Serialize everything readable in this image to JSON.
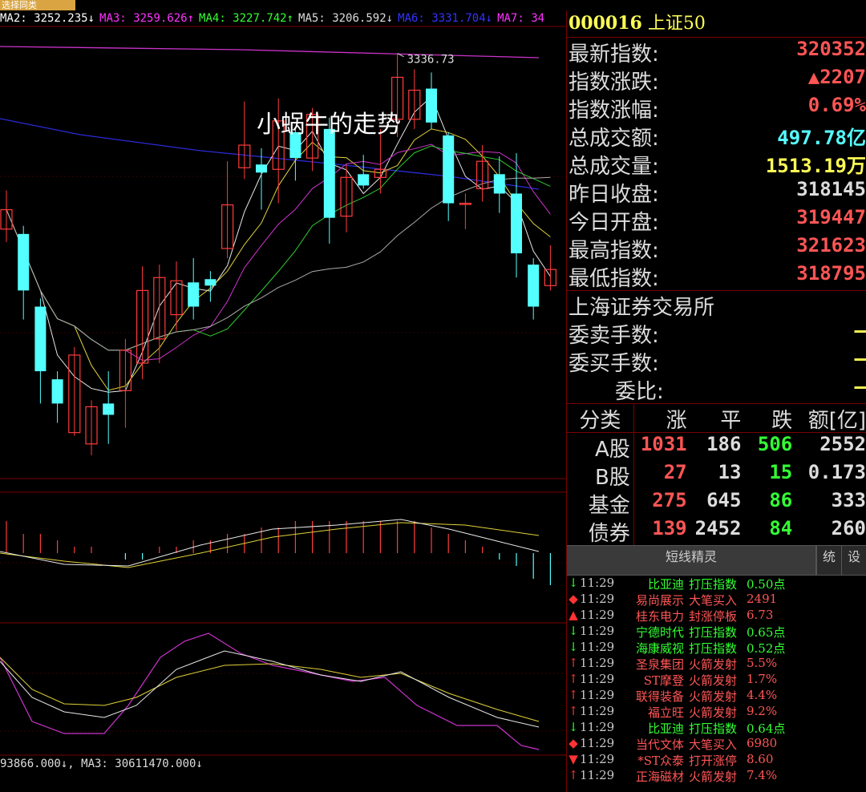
{
  "window": {
    "tab_label": "选择同类"
  },
  "overlay_title": "小蜗牛的走势",
  "ma_bar": [
    {
      "label": "MA2: 3252.235↓",
      "color": "#ffffff"
    },
    {
      "label": "MA3: 3259.626↑",
      "color": "#ff33ff"
    },
    {
      "label": "MA4: 3227.742↑",
      "color": "#33ff33"
    },
    {
      "label": "MA5: 3206.592↓",
      "color": "#dddddd"
    },
    {
      "label": "MA6: 3331.704↓",
      "color": "#3333ff"
    },
    {
      "label": "MA7: 34",
      "color": "#ff33ff"
    }
  ],
  "vol_bar": "93866.000↓, MA3: 30611470.000↓",
  "peak_label": "3336.73",
  "quote": {
    "code": "000016",
    "name": "上证50",
    "rows": [
      {
        "label": "最新指数:",
        "value": "320352",
        "color": "#ff5555"
      },
      {
        "label": "指数涨跌:",
        "value": "▲2207",
        "color": "#ff5555"
      },
      {
        "label": "指数涨幅:",
        "value": "0.69%",
        "color": "#ff5555"
      },
      {
        "label": "总成交额:",
        "value": "497.78亿",
        "color": "#55ffff"
      },
      {
        "label": "总成交量:",
        "value": "1513.19万",
        "color": "#ffff55"
      },
      {
        "label": "昨日收盘:",
        "value": "318145",
        "color": "#dcdcdc"
      },
      {
        "label": "今日开盘:",
        "value": "319447",
        "color": "#ff5555"
      },
      {
        "label": "最高指数:",
        "value": "321623",
        "color": "#ff5555"
      },
      {
        "label": "最低指数:",
        "value": "318795",
        "color": "#ff5555"
      }
    ],
    "exchange": "上海证券交易所",
    "order_rows": [
      {
        "label": "委卖手数:",
        "value": "—"
      },
      {
        "label": "委买手数:",
        "value": "—"
      },
      {
        "label": "委比:",
        "value": "—"
      }
    ]
  },
  "stats": {
    "headers": [
      "分类",
      "涨",
      "平",
      "跌",
      "额[亿]"
    ],
    "rows": [
      {
        "cat": "A股",
        "up": "1031",
        "flat": "186",
        "down": "506",
        "amt": "2552"
      },
      {
        "cat": "B股",
        "up": "27",
        "flat": "13",
        "down": "15",
        "amt": "0.173"
      },
      {
        "cat": "基金",
        "up": "275",
        "flat": "645",
        "down": "86",
        "amt": "333"
      },
      {
        "cat": "债券",
        "up": "139",
        "flat": "2452",
        "down": "84",
        "amt": "260"
      }
    ]
  },
  "tabs": {
    "main": "短线精灵",
    "t1": "统",
    "t2": "设"
  },
  "alerts": [
    {
      "mark": "↓",
      "mark_color": "#33ff33",
      "time": "11:29",
      "name": "比亚迪",
      "type": "打压指数",
      "value": "0.50点",
      "color": "#33ff33"
    },
    {
      "mark": "◆",
      "mark_color": "#ff3333",
      "time": "11:29",
      "name": "易尚展示",
      "type": "大笔买入",
      "value": "2491",
      "color": "#ff5555"
    },
    {
      "mark": "▲",
      "mark_color": "#ff3333",
      "time": "11:29",
      "name": "桂东电力",
      "type": "封涨停板",
      "value": "6.73",
      "color": "#ff5555"
    },
    {
      "mark": "↓",
      "mark_color": "#33ff33",
      "time": "11:29",
      "name": "宁德时代",
      "type": "打压指数",
      "value": "0.65点",
      "color": "#33ff33"
    },
    {
      "mark": "↓",
      "mark_color": "#33ff33",
      "time": "11:29",
      "name": "海康威视",
      "type": "打压指数",
      "value": "0.52点",
      "color": "#33ff33"
    },
    {
      "mark": "↑",
      "mark_color": "#ff3333",
      "time": "11:29",
      "name": "圣泉集团",
      "type": "火箭发射",
      "value": "5.5%",
      "color": "#ff5555"
    },
    {
      "mark": "↑",
      "mark_color": "#ff3333",
      "time": "11:29",
      "name": "ST摩登",
      "type": "火箭发射",
      "value": "1.7%",
      "color": "#ff5555"
    },
    {
      "mark": "↑",
      "mark_color": "#ff3333",
      "time": "11:29",
      "name": "联得装备",
      "type": "火箭发射",
      "value": "4.4%",
      "color": "#ff5555"
    },
    {
      "mark": "↑",
      "mark_color": "#ff3333",
      "time": "11:29",
      "name": "福立旺",
      "type": "火箭发射",
      "value": "9.2%",
      "color": "#ff5555"
    },
    {
      "mark": "↓",
      "mark_color": "#33ff33",
      "time": "11:29",
      "name": "比亚迪",
      "type": "打压指数",
      "value": "0.64点",
      "color": "#33ff33"
    },
    {
      "mark": "◆",
      "mark_color": "#ff3333",
      "time": "11:29",
      "name": "当代文体",
      "type": "大笔买入",
      "value": "6980",
      "color": "#ff5555"
    },
    {
      "mark": "▼",
      "mark_color": "#ff3333",
      "time": "11:29",
      "name": "*ST众泰",
      "type": "打开涨停",
      "value": "8.60",
      "color": "#ff5555"
    },
    {
      "mark": "↑",
      "mark_color": "#ff3333",
      "time": "11:29",
      "name": "正海磁材",
      "type": "火箭发射",
      "value": "7.4%",
      "color": "#ff5555"
    }
  ],
  "chart_data": {
    "type": "candlestick",
    "candles": [
      {
        "o": 3228,
        "c": 3240,
        "h": 3252,
        "l": 3220
      },
      {
        "o": 3225,
        "c": 3190,
        "h": 3230,
        "l": 3172
      },
      {
        "o": 3180,
        "c": 3140,
        "h": 3185,
        "l": 3120
      },
      {
        "o": 3135,
        "c": 3120,
        "h": 3140,
        "l": 3108
      },
      {
        "o": 3102,
        "c": 3150,
        "h": 3155,
        "l": 3100
      },
      {
        "o": 3095,
        "c": 3118,
        "h": 3122,
        "l": 3088
      },
      {
        "o": 3120,
        "c": 3113,
        "h": 3140,
        "l": 3095
      },
      {
        "o": 3128,
        "c": 3153,
        "h": 3160,
        "l": 3105
      },
      {
        "o": 3145,
        "c": 3190,
        "h": 3205,
        "l": 3135
      },
      {
        "o": 3160,
        "c": 3198,
        "h": 3206,
        "l": 3145
      },
      {
        "o": 3175,
        "c": 3196,
        "h": 3208,
        "l": 3165
      },
      {
        "o": 3195,
        "c": 3180,
        "h": 3210,
        "l": 3172
      },
      {
        "o": 3197,
        "c": 3193,
        "h": 3202,
        "l": 3183
      },
      {
        "o": 3216,
        "c": 3243,
        "h": 3270,
        "l": 3210
      },
      {
        "o": 3266,
        "c": 3280,
        "h": 3307,
        "l": 3259
      },
      {
        "o": 3268,
        "c": 3263,
        "h": 3278,
        "l": 3240
      },
      {
        "o": 3265,
        "c": 3295,
        "h": 3309,
        "l": 3244
      },
      {
        "o": 3288,
        "c": 3272,
        "h": 3290,
        "l": 3258
      },
      {
        "o": 3272,
        "c": 3299,
        "h": 3303,
        "l": 3264
      },
      {
        "o": 3290,
        "c": 3235,
        "h": 3297,
        "l": 3219
      },
      {
        "o": 3236,
        "c": 3260,
        "h": 3268,
        "l": 3226
      },
      {
        "o": 3262,
        "c": 3255,
        "h": 3274,
        "l": 3253
      },
      {
        "o": 3260,
        "c": 3265,
        "h": 3290,
        "l": 3250
      },
      {
        "o": 3296,
        "c": 3322,
        "h": 3336.73,
        "l": 3285
      },
      {
        "o": 3296,
        "c": 3314,
        "h": 3327,
        "l": 3290
      },
      {
        "o": 3315,
        "c": 3294,
        "h": 3325,
        "l": 3290
      },
      {
        "o": 3286,
        "c": 3244,
        "h": 3288,
        "l": 3233
      },
      {
        "o": 3244,
        "c": 3244,
        "h": 3250,
        "l": 3228
      },
      {
        "o": 3253,
        "c": 3270,
        "h": 3280,
        "l": 3245
      },
      {
        "o": 3262,
        "c": 3250,
        "h": 3273,
        "l": 3238
      },
      {
        "o": 3250,
        "c": 3213,
        "h": 3275,
        "l": 3198
      },
      {
        "o": 3206,
        "c": 3180,
        "h": 3210,
        "l": 3172
      },
      {
        "o": 3193,
        "c": 3203,
        "h": 3218,
        "l": 3190
      }
    ],
    "y_range": [
      3078,
      3350
    ],
    "peak_value": 3336.73,
    "macd_hist": [
      5,
      3,
      3,
      2,
      1,
      1,
      0,
      -1,
      -1,
      1,
      1,
      2,
      2,
      3,
      3,
      4,
      4,
      5,
      5,
      5,
      5,
      5,
      5,
      5,
      5,
      4,
      3,
      2,
      1,
      -1,
      -2,
      -4,
      -5
    ]
  }
}
